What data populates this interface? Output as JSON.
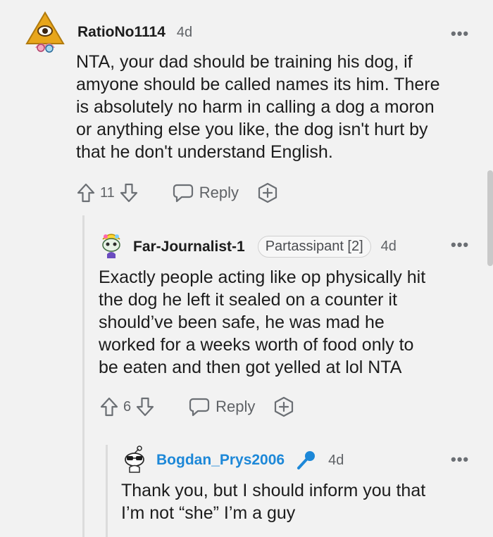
{
  "comments": [
    {
      "username": "RatioNo1114",
      "time": "4d",
      "body_lines": [
        "NTA, your dad should be training his dog, if",
        "amyone should be called names its him. There",
        "is absolutely no harm in calling a dog a moron",
        "or anything else you like, the dog isn't hurt by",
        "that he don't understand English."
      ],
      "score": "11",
      "reply_label": "Reply",
      "more": "•••"
    },
    {
      "username": "Far-Journalist-1",
      "flair": "Partassipant [2]",
      "time": "4d",
      "body_lines": [
        "Exactly people acting like op physically hit",
        "the dog he left it sealed on a counter it",
        "should’ve been safe, he was mad he",
        "worked for a weeks worth of food only to",
        "be eaten and then got yelled at lol NTA"
      ],
      "score": "6",
      "reply_label": "Reply",
      "more": "•••"
    },
    {
      "username": "Bogdan_Prys2006",
      "time": "4d",
      "body_lines": [
        "Thank you, but I should inform you that",
        "I’m not “she” I’m a guy"
      ],
      "more": "•••"
    }
  ],
  "colors": {
    "background": "#f2f2f2",
    "op_username": "#1d88d8",
    "muted": "#6b6f74",
    "thread_line": "#dcdcdc"
  }
}
